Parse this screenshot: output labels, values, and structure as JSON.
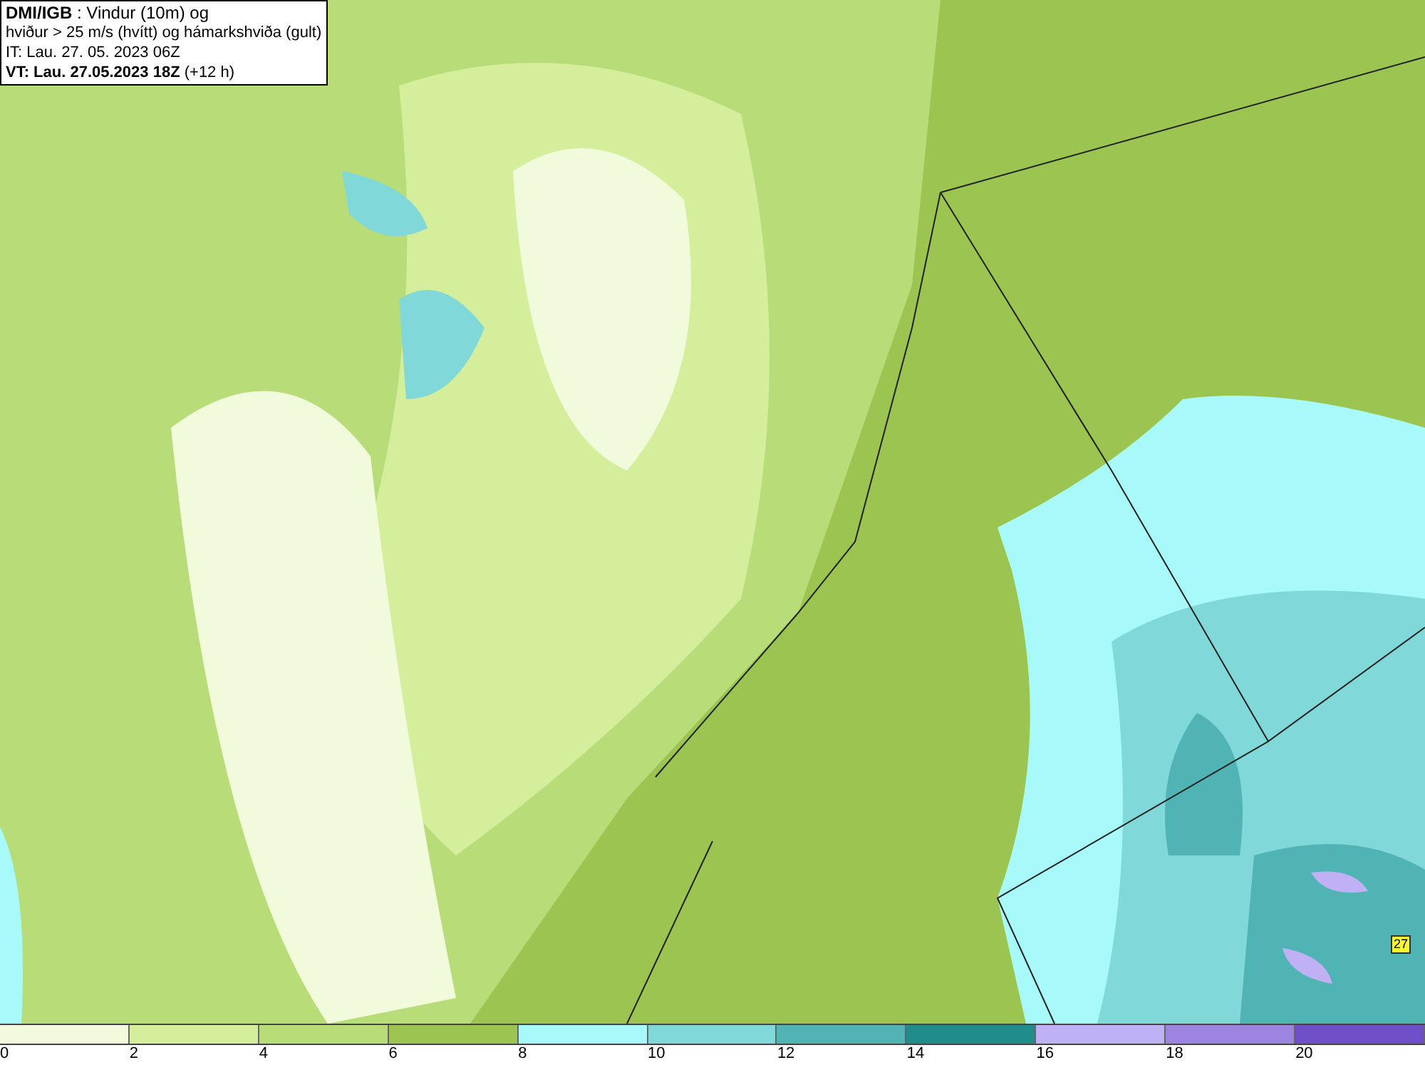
{
  "title_box": {
    "lines": [
      "**DMI/IGB** : Vindur (10m) og",
      "hviður > 25 m/s (hvítt) og hámarkshviða (gult)",
      "IT: Lau. 27. 05. 2023 06Z",
      "**VT: Lau. 27.05.2023 18Z** (+12 h)"
    ]
  },
  "map": {
    "max_gust_label": "27"
  },
  "legend": [
    {
      "label": "0",
      "color": "#f2fadc"
    },
    {
      "label": "2",
      "color": "#d4ee9c"
    },
    {
      "label": "4",
      "color": "#b8dc78"
    },
    {
      "label": "6",
      "color": "#9cc450"
    },
    {
      "label": "8",
      "color": "#a8fafa"
    },
    {
      "label": "10",
      "color": "#80d8d8"
    },
    {
      "label": "12",
      "color": "#50b4b4"
    },
    {
      "label": "14",
      "color": "#208c8c"
    },
    {
      "label": "16",
      "color": "#c0b0f4"
    },
    {
      "label": "18",
      "color": "#9c84e0"
    },
    {
      "label": "20",
      "color": "#7050c8"
    }
  ]
}
